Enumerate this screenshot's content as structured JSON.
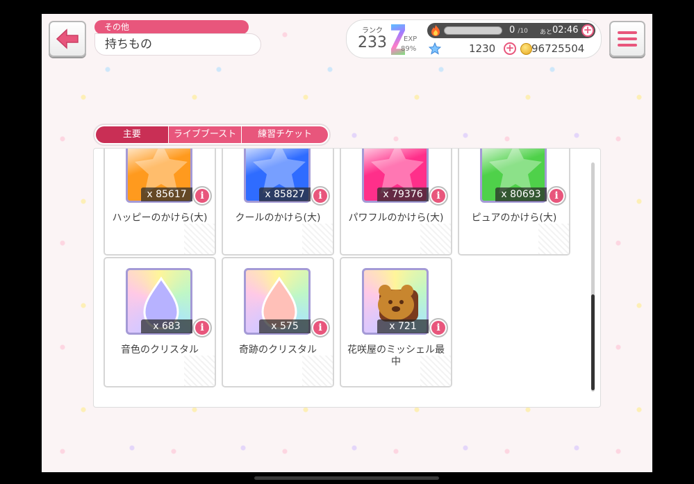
{
  "header": {
    "category": "その他",
    "title": "持ちもの"
  },
  "status": {
    "rank_label": "ランク",
    "rank": "233",
    "exp_label": "EXP",
    "exp_percent": "89%",
    "stamina_current": "0",
    "stamina_max": "/10",
    "stamina_timer_label": "あと",
    "stamina_timer": "02:46",
    "stars": "1230",
    "coins": "96725504",
    "plus_symbol": "+"
  },
  "tabs": [
    {
      "label": "主要",
      "active": true
    },
    {
      "label": "ライブブースト",
      "active": false
    },
    {
      "label": "練習チケット",
      "active": false
    }
  ],
  "items": [
    {
      "name": "ハッピーのかけら(大)",
      "count": "x 85617",
      "icon": "happy-shard-icon",
      "color": "#ff9a1e"
    },
    {
      "name": "クールのかけら(大)",
      "count": "x 85827",
      "icon": "cool-shard-icon",
      "color": "#2f6cff"
    },
    {
      "name": "パワフルのかけら(大)",
      "count": "x 79376",
      "icon": "powerful-shard-icon",
      "color": "#ff2f8a"
    },
    {
      "name": "ピュアのかけら(大)",
      "count": "x 80693",
      "icon": "pure-shard-icon",
      "color": "#4fd14a"
    },
    {
      "name": "音色のクリスタル",
      "count": "x 683",
      "icon": "tone-crystal-icon",
      "color": "#b7b2ff"
    },
    {
      "name": "奇跡のクリスタル",
      "count": "x 575",
      "icon": "miracle-crystal-icon",
      "color": "#ffc0b8"
    },
    {
      "name": "花咲屋のミッシェル最中",
      "count": "x 721",
      "icon": "michelle-monaka-icon",
      "color": "#c8862f"
    }
  ],
  "info_label": "i",
  "colors": {
    "accent": "#e8567c",
    "accent_dark": "#c92f55"
  }
}
